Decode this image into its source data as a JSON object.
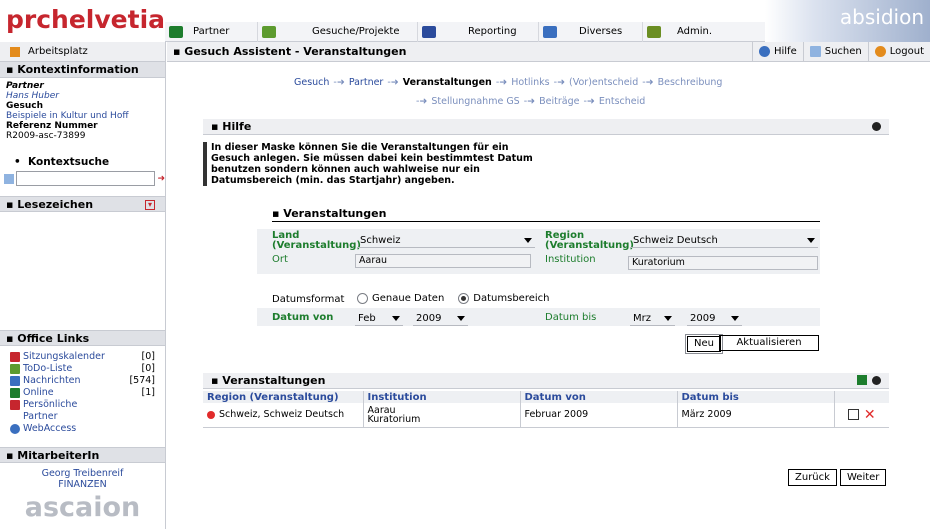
{
  "app": {
    "logo": "prchelvetia",
    "brand": "absidion",
    "footer_logo": "ascaion"
  },
  "topnav": [
    {
      "label": "Partner",
      "icon": "partner-icon",
      "color": "#1d7d2d"
    },
    {
      "label": "Gesuche/Projekte",
      "icon": "projects-icon",
      "color": "#5d9b2f"
    },
    {
      "label": "Reporting",
      "icon": "reporting-icon",
      "color": "#2b4b9c"
    },
    {
      "label": "Diverses",
      "icon": "diverses-icon",
      "color": "#3a6fbf"
    },
    {
      "label": "Admin.",
      "icon": "admin-icon",
      "color": "#6b8e23"
    }
  ],
  "header": {
    "title": "Gesuch Assistent - Veranstaltungen",
    "home": "Arbeitsplatz",
    "help": "Hilfe",
    "search": "Suchen",
    "logout": "Logout"
  },
  "left": {
    "context_title": "Kontextinformation",
    "partner_label": "Partner",
    "partner_name": "Hans Huber",
    "gesuch_label": "Gesuch",
    "gesuch_value": "Beispiele in Kultur und Hoff",
    "ref_label": "Referenz Nummer",
    "ref_value": "R2009-asc-73899",
    "kontextsuche": "Kontextsuche",
    "search_value": "",
    "lesezeichen": "Lesezeichen",
    "office_links": "Office Links",
    "office_items": [
      {
        "label": "Sitzungskalender",
        "count": "[0]",
        "color": "#c6262e"
      },
      {
        "label": "ToDo-Liste",
        "count": "[0]",
        "color": "#5d9b2f"
      },
      {
        "label": "Nachrichten",
        "count": "[574]",
        "color": "#3a6fbf"
      },
      {
        "label": "Online",
        "count": "[1]",
        "color": "#1d7d2d"
      },
      {
        "label": "Persönliche Partner",
        "count": "",
        "color": "#c6262e"
      },
      {
        "label": "WebAccess",
        "count": "",
        "color": "#3a6fbf"
      }
    ],
    "mitarbeiter_title": "MitarbeiterIn",
    "mitarbeiter_name": "Georg Treibenreif",
    "mitarbeiter_dept": "FINANZEN"
  },
  "steps": {
    "line1": [
      "Gesuch",
      "Partner",
      "Veranstaltungen",
      "Hotlinks",
      "(Vor)entscheid",
      "Beschreibung"
    ],
    "line2": [
      "Stellungnahme GS",
      "Beiträge",
      "Entscheid"
    ],
    "current": "Veranstaltungen"
  },
  "hilfe": {
    "title": "Hilfe",
    "text": "In dieser Maske können Sie die Veranstaltungen für ein Gesuch anlegen. Sie müssen dabei kein bestimmtest Datum benutzen sondern können auch wahlweise nur ein Datumsbereich (min. das Startjahr) angeben."
  },
  "form": {
    "title": "Veranstaltungen",
    "land_label": "Land (Veranstaltung)",
    "land_value": "Schweiz",
    "region_label": "Region (Veranstaltung)",
    "region_value": "Schweiz Deutsch",
    "ort_label": "Ort",
    "ort_value": "Aarau",
    "institution_label": "Institution",
    "institution_value": "Kuratorium",
    "datumsformat_label": "Datumsformat",
    "opt_genau": "Genaue Daten",
    "opt_bereich": "Datumsbereich",
    "datum_von_label": "Datum von",
    "von_month": "Feb",
    "von_year": "2009",
    "datum_bis_label": "Datum bis",
    "bis_month": "Mrz",
    "bis_year": "2009",
    "neu": "Neu",
    "aktualisieren": "Aktualisieren"
  },
  "table": {
    "title": "Veranstaltungen",
    "columns": [
      "Region (Veranstaltung)",
      "Institution",
      "Datum von",
      "Datum bis"
    ],
    "rows": [
      {
        "region": "Schweiz, Schweiz Deutsch",
        "institution_line1": "Aarau",
        "institution_line2": "Kuratorium",
        "von": "Februar 2009",
        "bis": "März 2009"
      }
    ]
  },
  "footer": {
    "back": "Zurück",
    "next": "Weiter"
  }
}
